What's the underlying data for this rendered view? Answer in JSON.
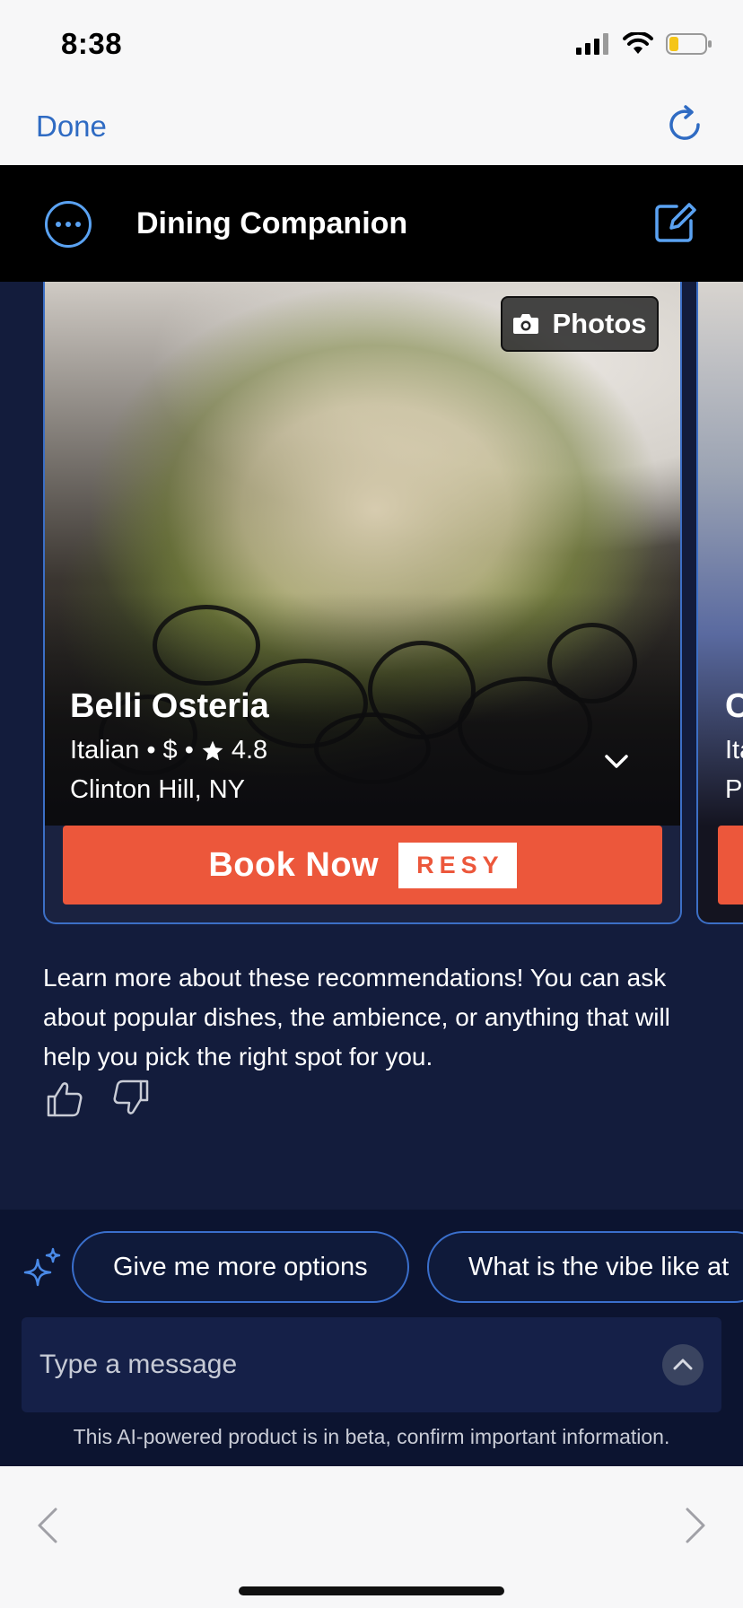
{
  "status_bar": {
    "time": "8:38"
  },
  "top_nav": {
    "done_label": "Done"
  },
  "header": {
    "title": "Dining Companion"
  },
  "card": {
    "photos_label": "Photos",
    "name": "Belli Osteria",
    "cuisine": "Italian",
    "price": "$",
    "rating": "4.8",
    "location": "Clinton Hill, NY",
    "book_label": "Book Now",
    "partner_label": "RESY"
  },
  "next_card": {
    "name_partial": "C",
    "meta_partial": "Ita",
    "loc_partial": "P"
  },
  "info_text": "Learn more about these recommendations! You can ask about popular dishes, the ambience, or anything that will help you pick the right spot for you.",
  "suggestions": [
    {
      "label": "Give me more options"
    },
    {
      "label": "What is the vibe like at"
    }
  ],
  "message": {
    "placeholder": "Type a message"
  },
  "disclaimer": "This AI-powered product is in beta, confirm important information.",
  "colors": {
    "accent": "#2f6bc3",
    "book": "#ec573b",
    "body_bg": "#131c3c"
  },
  "icons": {
    "menu": "ellipsis-circle-icon",
    "compose": "compose-icon",
    "refresh": "refresh-icon",
    "camera": "camera-icon",
    "star": "star-icon",
    "chevron": "chevron-down-icon",
    "thumbs_up": "thumbs-up-icon",
    "thumbs_down": "thumbs-down-icon",
    "sparkle": "sparkle-icon",
    "send": "chevron-up-icon"
  }
}
